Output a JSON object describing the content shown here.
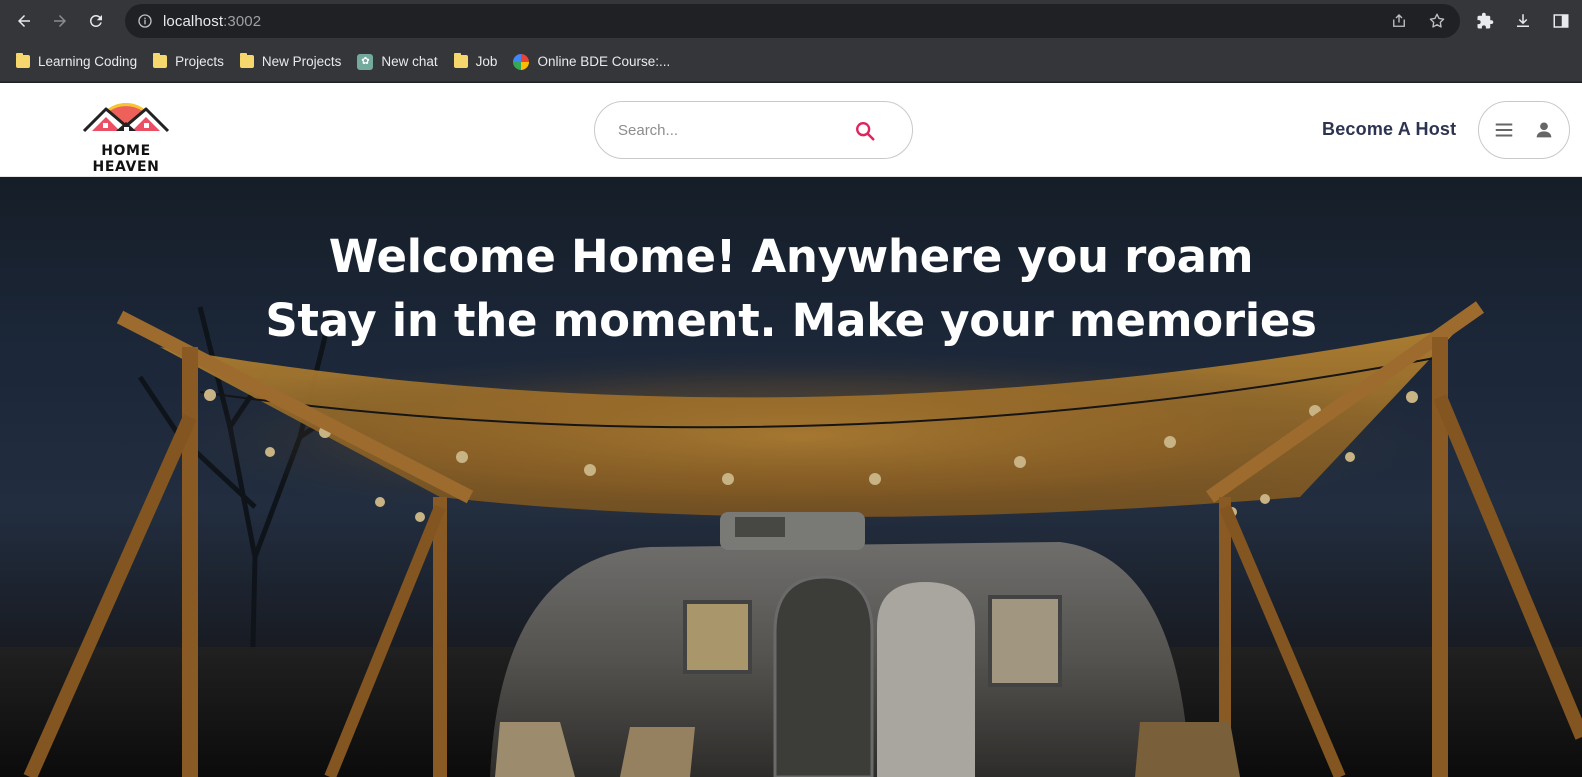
{
  "browser": {
    "url_host": "localhost",
    "url_port": ":3002",
    "bookmarks": [
      {
        "label": "Learning Coding",
        "icon": "folder-icon"
      },
      {
        "label": "Projects",
        "icon": "folder-icon"
      },
      {
        "label": "New Projects",
        "icon": "folder-icon"
      },
      {
        "label": "New chat",
        "icon": "chatgpt-favicon"
      },
      {
        "label": "Job",
        "icon": "folder-icon"
      },
      {
        "label": "Online BDE Course:...",
        "icon": "google-favicon"
      }
    ]
  },
  "site": {
    "logo_text": "HOME HEAVEN",
    "search": {
      "placeholder": "Search..."
    },
    "host_link": "Become A Host",
    "colors": {
      "accent": "#e0245e",
      "host_text": "#2d3452"
    }
  },
  "hero": {
    "line1": "Welcome Home! Anywhere you roam",
    "line2": "Stay in the moment. Make your memories"
  }
}
